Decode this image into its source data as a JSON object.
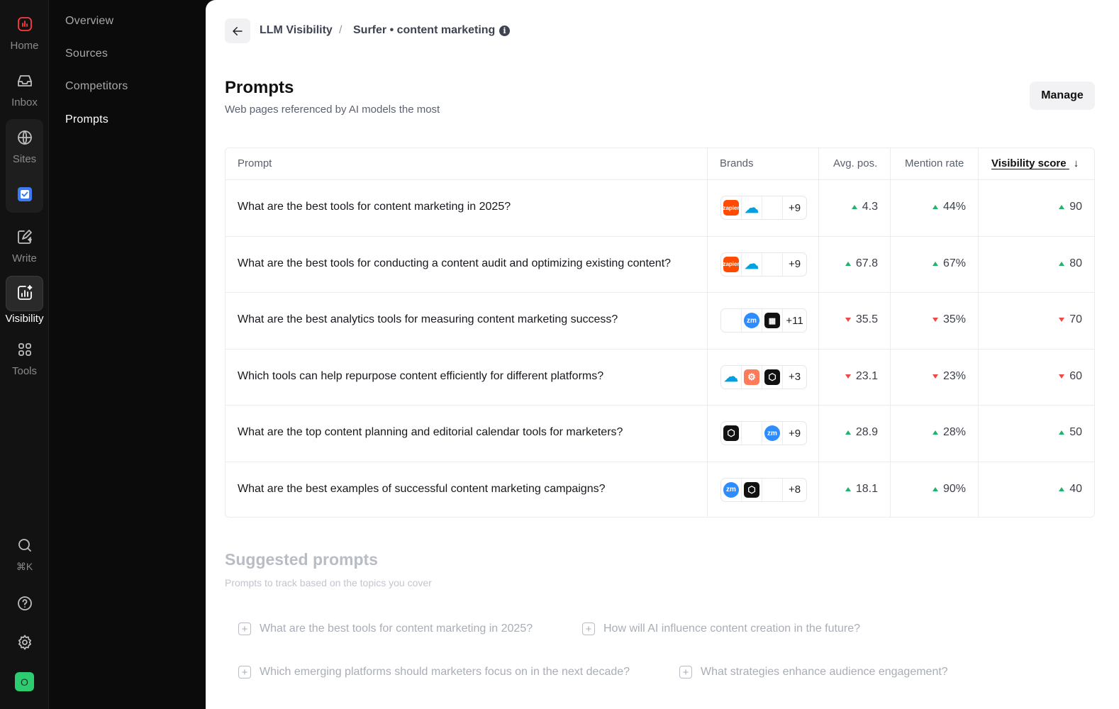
{
  "rail": {
    "home": "Home",
    "inbox": "Inbox",
    "sites": "Sites",
    "write": "Write",
    "visibility": "Visibility",
    "tools": "Tools",
    "search_shortcut": "⌘K",
    "avatar_initial": "O"
  },
  "subnav": [
    "Overview",
    "Sources",
    "Competitors",
    "Prompts"
  ],
  "breadcrumb": {
    "parent": "LLM Visibility",
    "separator": "/",
    "current": "Surfer • content marketing"
  },
  "header": {
    "title": "Prompts",
    "subtitle": "Web pages referenced by AI models the most",
    "manage": "Manage"
  },
  "table": {
    "columns": [
      "Prompt",
      "Brands",
      "Avg. pos.",
      "Mention rate",
      "Visibility score"
    ],
    "rows": [
      {
        "prompt": "What are the best tools for content marketing in 2025?",
        "brands": [
          "zapier",
          "salesforce",
          "apple"
        ],
        "more": "+9",
        "avg_pos": "4.3",
        "avg_dir": "up",
        "mention": "44%",
        "mention_dir": "up",
        "score": "90",
        "score_dir": "up"
      },
      {
        "prompt": "What are the best tools for conducting a content audit and optimizing existing content?",
        "brands": [
          "zapier",
          "salesforce",
          "apple"
        ],
        "more": "+9",
        "avg_pos": "67.8",
        "avg_dir": "up",
        "mention": "67%",
        "mention_dir": "up",
        "score": "80",
        "score_dir": "up"
      },
      {
        "prompt": "What are the best analytics tools for measuring content marketing success?",
        "brands": [
          "apple",
          "zoom",
          "intercom"
        ],
        "more": "+11",
        "avg_pos": "35.5",
        "avg_dir": "down",
        "mention": "35%",
        "mention_dir": "down",
        "score": "70",
        "score_dir": "down"
      },
      {
        "prompt": "Which tools can help repurpose content efficiently for different platforms?",
        "brands": [
          "salesforce",
          "hubspot",
          "cube"
        ],
        "more": "+3",
        "avg_pos": "23.1",
        "avg_dir": "down",
        "mention": "23%",
        "mention_dir": "down",
        "score": "60",
        "score_dir": "down"
      },
      {
        "prompt": "What are the top content planning and editorial calendar tools for marketers?",
        "brands": [
          "cube",
          "apple",
          "zoom"
        ],
        "more": "+9",
        "avg_pos": "28.9",
        "avg_dir": "up",
        "mention": "28%",
        "mention_dir": "up",
        "score": "50",
        "score_dir": "up"
      },
      {
        "prompt": "What are the best examples of successful content marketing campaigns?",
        "brands": [
          "zoom",
          "cube",
          "apple"
        ],
        "more": "+8",
        "avg_pos": "18.1",
        "avg_dir": "up",
        "mention": "90%",
        "mention_dir": "up",
        "score": "40",
        "score_dir": "up"
      }
    ]
  },
  "suggested": {
    "title": "Suggested prompts",
    "subtitle": "Prompts to track based on the topics you cover",
    "items": [
      "What are the best tools for content marketing in 2025?",
      "How will AI influence content creation in the future?",
      "Which emerging platforms should marketers focus on in the next decade?",
      "What strategies enhance audience engagement?"
    ]
  },
  "colors": {
    "up": "#22b36b",
    "down": "#ec4a4a",
    "zapier": "#ff4a00",
    "salesforce": "#00a1e0",
    "zoom": "#2d8cff",
    "hubspot": "#ff7a59"
  }
}
